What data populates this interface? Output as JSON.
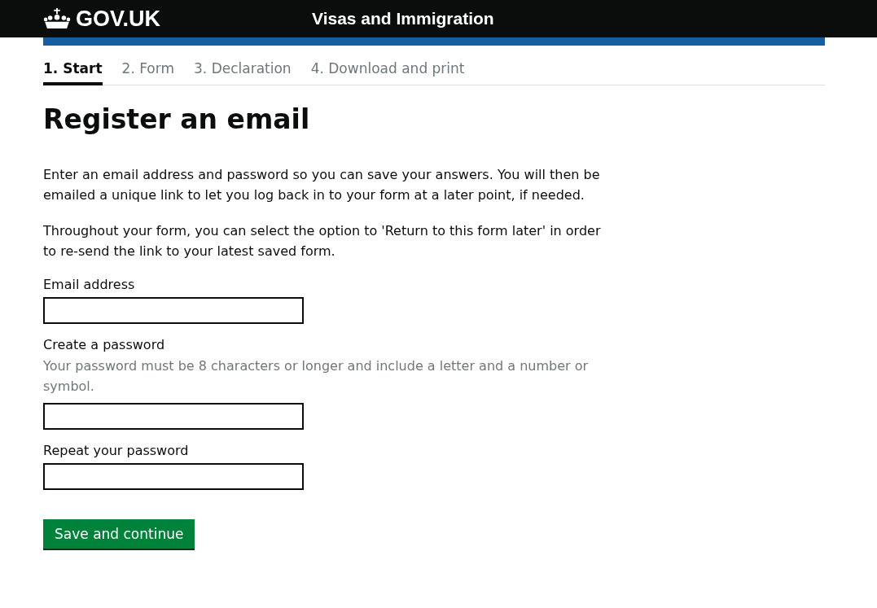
{
  "header": {
    "logo": "GOV.UK",
    "service": "Visas and Immigration"
  },
  "steps": [
    {
      "label": "1. Start",
      "selected": true
    },
    {
      "label": "2. Form",
      "selected": false
    },
    {
      "label": "3. Declaration",
      "selected": false
    },
    {
      "label": "4. Download and print",
      "selected": false
    }
  ],
  "heading": "Register an email",
  "paragraphs": [
    "Enter an email address and password so you can save your answers. You will then be emailed a unique link to let you log back in to your form at a later point, if needed.",
    "Throughout your form, you can select the option to 'Return to this form later' in order to re-send the link to your latest saved form."
  ],
  "fields": [
    {
      "label": "Email address"
    },
    {
      "label": "Create a password",
      "hint": "Your password must be 8 characters or longer and include a letter and a number or symbol."
    },
    {
      "label": "Repeat your password"
    }
  ],
  "button": "Save and continue"
}
